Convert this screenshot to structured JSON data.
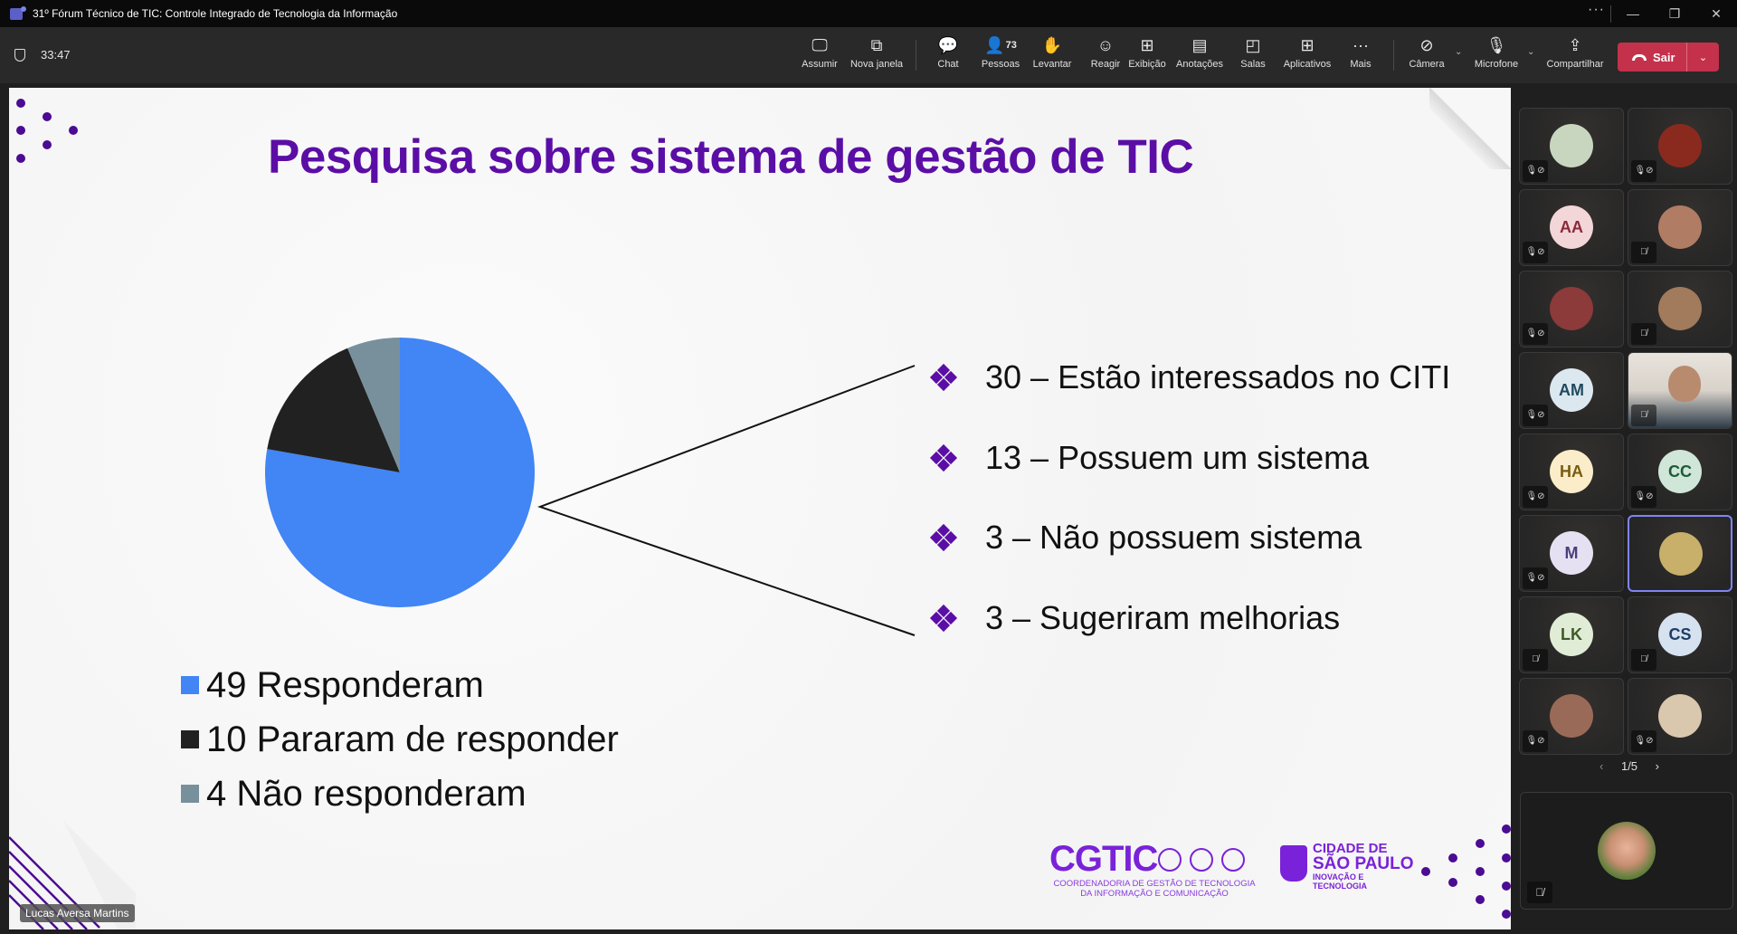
{
  "window": {
    "title": "31º Fórum Técnico de TIC: Controle Integrado de Tecnologia da Informação",
    "more": "···",
    "minimize": "—",
    "restore": "❐",
    "close": "✕"
  },
  "meeting": {
    "timer": "33:47",
    "toolbar": [
      {
        "id": "assumir",
        "label": "Assumir",
        "icon": "take-control-icon",
        "glyph": "🖵"
      },
      {
        "id": "nova-janela",
        "label": "Nova janela",
        "icon": "pop-out-icon",
        "glyph": "⧉"
      },
      {
        "id": "chat",
        "label": "Chat",
        "icon": "chat-icon",
        "glyph": "💬"
      },
      {
        "id": "pessoas",
        "label": "Pessoas",
        "icon": "people-icon",
        "glyph": "👤",
        "count": "73"
      },
      {
        "id": "levantar",
        "label": "Levantar",
        "icon": "raise-hand-icon",
        "glyph": "✋"
      },
      {
        "id": "reagir",
        "label": "Reagir",
        "icon": "react-icon",
        "glyph": "☺"
      },
      {
        "id": "exibicao",
        "label": "Exibição",
        "icon": "view-icon",
        "glyph": "⊞"
      },
      {
        "id": "anotacoes",
        "label": "Anotações",
        "icon": "notes-icon",
        "glyph": "▤"
      },
      {
        "id": "salas",
        "label": "Salas",
        "icon": "rooms-icon",
        "glyph": "◰"
      },
      {
        "id": "aplicativos",
        "label": "Aplicativos",
        "icon": "apps-icon",
        "glyph": "⊞"
      },
      {
        "id": "mais",
        "label": "Mais",
        "icon": "more-icon",
        "glyph": "···"
      },
      {
        "id": "camera",
        "label": "Câmera",
        "icon": "camera-off-icon",
        "glyph": "⊘"
      },
      {
        "id": "microfone",
        "label": "Microfone",
        "icon": "mic-off-icon",
        "glyph": "🎙"
      },
      {
        "id": "compartilhar",
        "label": "Compartilhar",
        "icon": "share-icon",
        "glyph": "⇪"
      }
    ],
    "leave_label": "Sair",
    "caret": "⌄"
  },
  "slide": {
    "title": "Pesquisa sobre sistema de gestão de TIC",
    "bullets": [
      "30 – Estão interessados no CITI",
      "13 – Possuem um sistema",
      "3 – Não possuem sistema",
      "3 – Sugeriram melhorias"
    ],
    "logo_cgtic": {
      "word": "CGTIC",
      "subtitle_line1": "COORDENADORIA DE GESTÃO DE TECNOLOGIA",
      "subtitle_line2": "DA INFORMAÇÃO E COMUNICAÇÃO"
    },
    "logo_sp": {
      "line1": "CIDADE DE",
      "line2": "SÃO PAULO",
      "line3": "INOVAÇÃO E",
      "line4": "TECNOLOGIA"
    },
    "accent_color": "#5b0ea6"
  },
  "chart_data": {
    "type": "pie",
    "title": "",
    "categories": [
      "49 Responderam",
      "10 Pararam de responder",
      "4 Não responderam"
    ],
    "values": [
      49,
      10,
      4
    ],
    "colors": [
      "#4285f4",
      "#212121",
      "#78909c"
    ],
    "legend": "bottom",
    "start_angle": "12 o'clock, clockwise"
  },
  "speaker_name": "Lucas Aversa Martins",
  "participants": {
    "tiles": [
      {
        "initials": "",
        "kind": "photo",
        "mic": "muted-by-organizer",
        "bg": "#c8d6c0"
      },
      {
        "initials": "",
        "kind": "photo",
        "mic": "muted-by-organizer",
        "bg": "#8a2a1e"
      },
      {
        "initials": "AA",
        "kind": "initials",
        "mic": "muted-by-organizer",
        "bg": "#f3d6d8",
        "fg": "#8a2a3a"
      },
      {
        "initials": "",
        "kind": "photo",
        "mic": "muted",
        "bg": "#b07c64"
      },
      {
        "initials": "",
        "kind": "photo",
        "mic": "muted-by-organizer",
        "bg": "#8c3a3a"
      },
      {
        "initials": "",
        "kind": "photo",
        "mic": "muted",
        "bg": "#a27a5c"
      },
      {
        "initials": "AM",
        "kind": "initials",
        "mic": "muted-by-organizer",
        "bg": "#dce8ef",
        "fg": "#1f4a5e"
      },
      {
        "initials": "",
        "kind": "video",
        "mic": "muted",
        "bg": ""
      },
      {
        "initials": "HA",
        "kind": "initials",
        "mic": "muted-by-organizer",
        "bg": "#fbedc9",
        "fg": "#7a5b10"
      },
      {
        "initials": "CC",
        "kind": "initials",
        "mic": "muted-by-organizer",
        "bg": "#cfe6d8",
        "fg": "#1e5a3a"
      },
      {
        "initials": "M",
        "kind": "initials",
        "mic": "muted-by-organizer",
        "bg": "#e6e1f2",
        "fg": "#4d3d7a"
      },
      {
        "initials": "",
        "kind": "photo",
        "mic": "none",
        "bg": "#c8b06a",
        "active": true
      },
      {
        "initials": "LK",
        "kind": "initials",
        "mic": "muted",
        "bg": "#e1ecd6",
        "fg": "#3f5a28"
      },
      {
        "initials": "CS",
        "kind": "initials",
        "mic": "muted",
        "bg": "#d6e2f0",
        "fg": "#1e3e66"
      },
      {
        "initials": "",
        "kind": "photo",
        "mic": "muted-by-organizer",
        "bg": "#9a6a58"
      },
      {
        "initials": "",
        "kind": "photo",
        "mic": "muted-by-organizer",
        "bg": "#d9c7ae"
      }
    ],
    "page": "1/5",
    "prev": "‹",
    "next": "›"
  }
}
